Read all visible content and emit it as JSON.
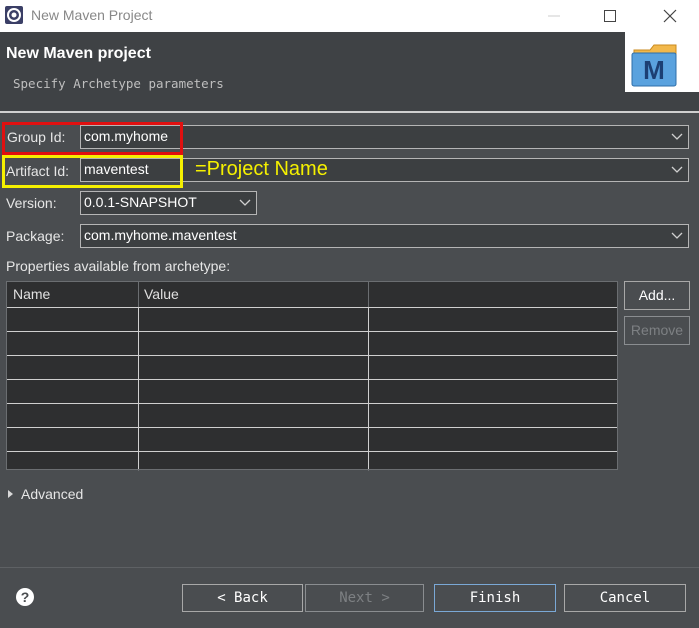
{
  "window": {
    "title": "New Maven Project"
  },
  "header": {
    "title": "New Maven project",
    "description": "Specify Archetype parameters",
    "logo_letter": "M"
  },
  "form": {
    "group_id": {
      "label": "Group Id:",
      "value": "com.myhome"
    },
    "artifact_id": {
      "label": "Artifact Id:",
      "value": "maventest"
    },
    "version": {
      "label": "Version:",
      "value": "0.0.1-SNAPSHOT"
    },
    "package": {
      "label": "Package:",
      "value": "com.myhome.maventest"
    },
    "annotation": "=Project Name",
    "annotation_colors": {
      "group_box": "#e01010",
      "artifact_box": "#f5f000",
      "text": "#f5f000"
    }
  },
  "properties": {
    "label": "Properties available from archetype:",
    "columns": [
      "Name",
      "Value"
    ],
    "rows": [],
    "add_label": "Add...",
    "remove_label": "Remove"
  },
  "advanced": {
    "label": "Advanced"
  },
  "footer": {
    "back_label": "< Back",
    "next_label": "Next >",
    "finish_label": "Finish",
    "cancel_label": "Cancel"
  }
}
